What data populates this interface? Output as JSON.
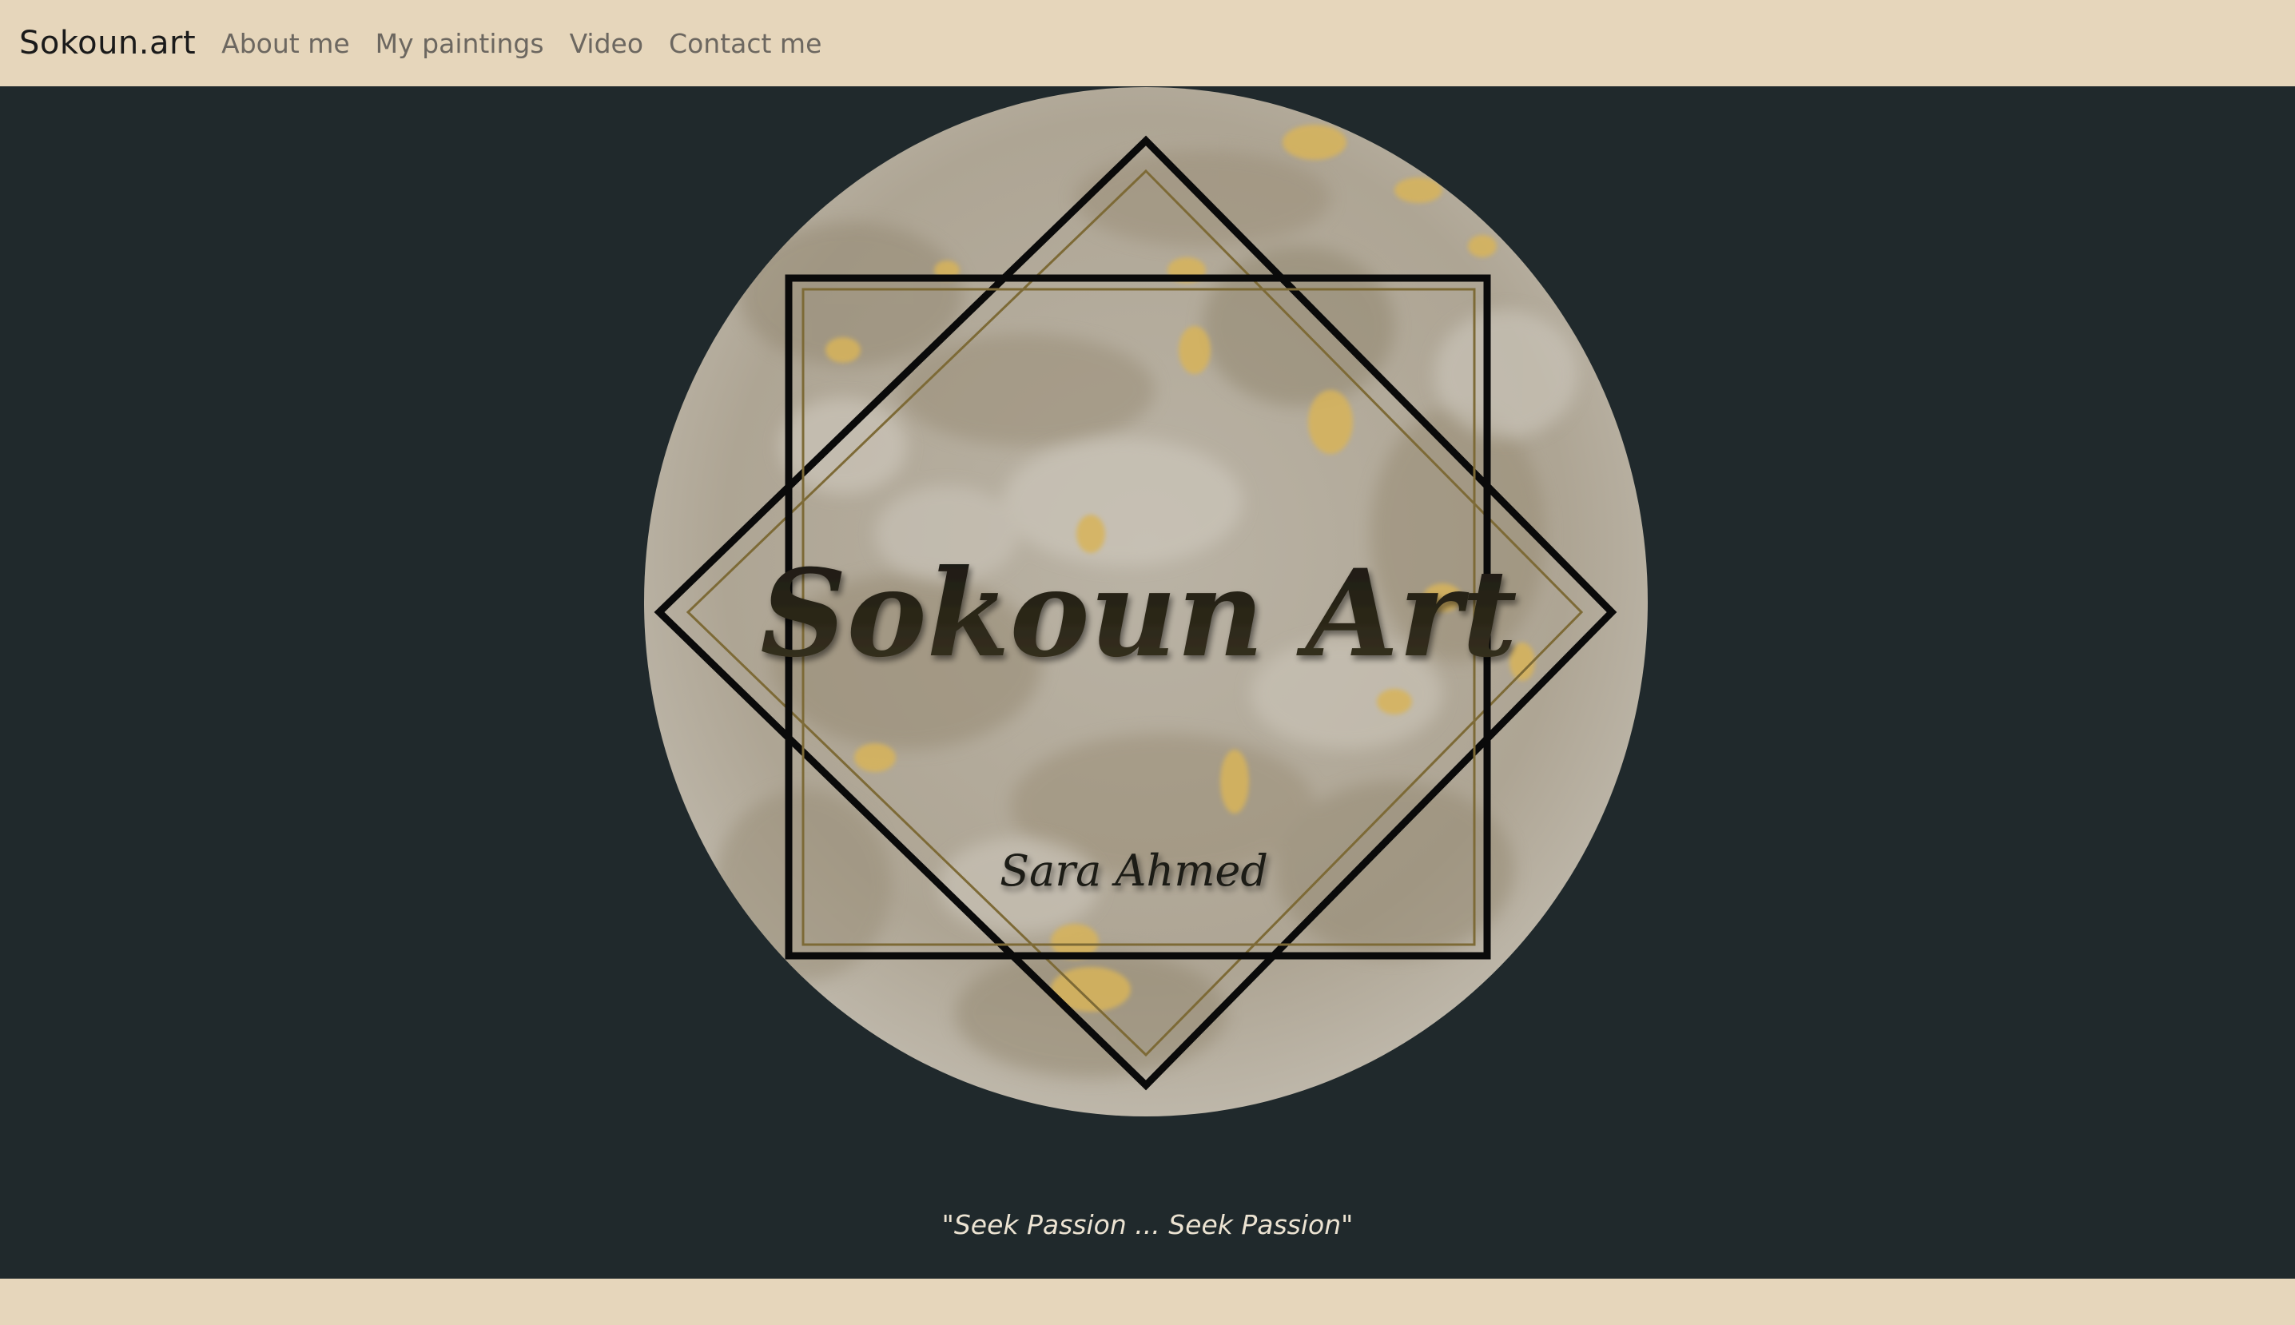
{
  "navbar": {
    "brand": "Sokoun.art",
    "links": [
      "About me",
      "My paintings",
      "Video",
      "Contact me"
    ]
  },
  "hero": {
    "logo": {
      "title": "Sokoun Art",
      "signature": "Sara Ahmed"
    },
    "tagline": "\"Seek Passion ... Seek Passion\""
  },
  "colors": {
    "navbar_bg": "#e6d6bb",
    "page_bg": "#20292c",
    "marble_base": "#b3aa9a",
    "gold_accent": "#d8b45a",
    "frame_line": "#0a0a0a"
  },
  "icons": {
    "logo": "sokoun-art-logo"
  }
}
